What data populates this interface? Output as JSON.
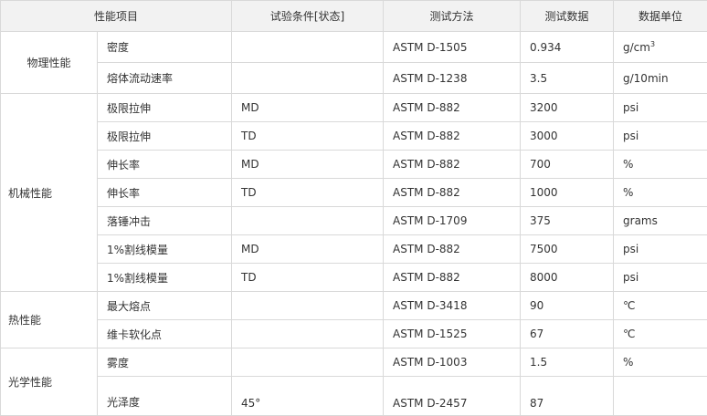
{
  "headers": [
    "性能项目",
    "试验条件[状态]",
    "测试方法",
    "测试数据",
    "数据单位"
  ],
  "groups": {
    "physical": "物理性能",
    "mechanical": "机械性能",
    "thermal": "热性能",
    "optical": "光学性能"
  },
  "rows": [
    {
      "item": "密度",
      "condition": "",
      "method": "ASTM D-1505",
      "value": "0.934",
      "unit": "g/cm",
      "unit_sup": "3"
    },
    {
      "item": "熔体流动速率",
      "condition": "",
      "method": "ASTM D-1238",
      "value": "3.5",
      "unit": "g/10min"
    },
    {
      "item": "极限拉伸",
      "condition": "MD",
      "method": "ASTM D-882",
      "value": "3200",
      "unit": "psi"
    },
    {
      "item": "极限拉伸",
      "condition": "TD",
      "method": "ASTM D-882",
      "value": "3000",
      "unit": "psi"
    },
    {
      "item": "伸长率",
      "condition": "MD",
      "method": "ASTM D-882",
      "value": "700",
      "unit": "%"
    },
    {
      "item": "伸长率",
      "condition": "TD",
      "method": "ASTM D-882",
      "value": "1000",
      "unit": "%"
    },
    {
      "item": "落锤冲击",
      "condition": "",
      "method": "ASTM D-1709",
      "value": "375",
      "unit": "grams"
    },
    {
      "item": "1%割线模量",
      "condition": "MD",
      "method": "ASTM D-882",
      "value": "7500",
      "unit": "psi"
    },
    {
      "item": "1%割线模量",
      "condition": "TD",
      "method": "ASTM D-882",
      "value": "8000",
      "unit": "psi"
    },
    {
      "item": "最大熔点",
      "condition": "",
      "method": "ASTM D-3418",
      "value": "90",
      "unit": "℃"
    },
    {
      "item": "维卡软化点",
      "condition": "",
      "method": "ASTM D-1525",
      "value": "67",
      "unit": "℃"
    },
    {
      "item": "雾度",
      "condition": "",
      "method": "ASTM D-1003",
      "value": "1.5",
      "unit": "%"
    },
    {
      "item": "光泽度",
      "condition": "45°",
      "method": "ASTM D-2457",
      "value": "87",
      "unit": ""
    }
  ]
}
